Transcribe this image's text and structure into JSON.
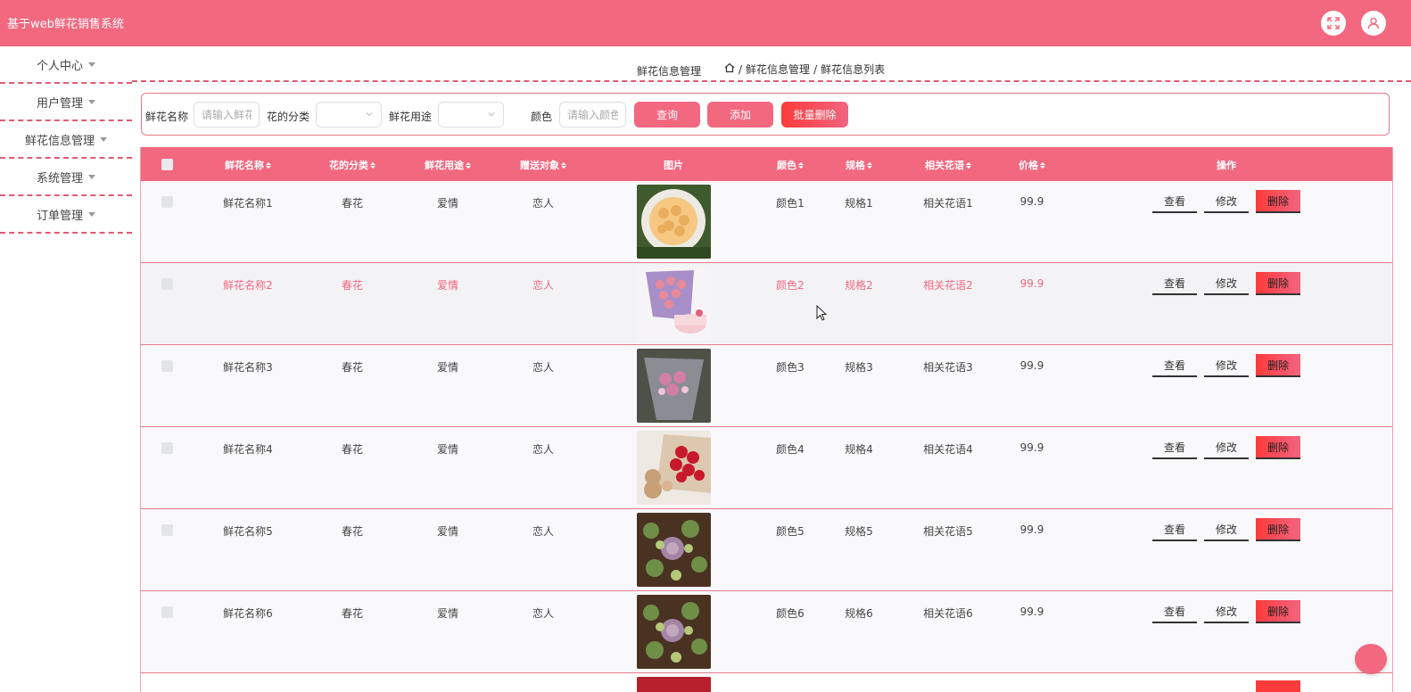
{
  "header": {
    "app_title": "基于web鲜花销售系统"
  },
  "sidebar": {
    "items": [
      {
        "label": "个人中心"
      },
      {
        "label": "用户管理"
      },
      {
        "label": "鲜花信息管理"
      },
      {
        "label": "系统管理"
      },
      {
        "label": "订单管理"
      }
    ]
  },
  "breadcrumb": {
    "page_title": "鲜花信息管理",
    "level1": "鲜花信息管理",
    "level2": "鲜花信息列表"
  },
  "search": {
    "name_label": "鲜花名称",
    "name_placeholder": "请输入鲜花名称",
    "category_label": "花的分类",
    "usage_label": "鲜花用途",
    "color_label": "颜色",
    "color_placeholder": "请输入颜色",
    "query_btn": "查询",
    "add_btn": "添加",
    "batch_delete_btn": "批量删除"
  },
  "table": {
    "headers": {
      "name": "鲜花名称",
      "category": "花的分类",
      "usage": "鲜花用途",
      "target": "赠送对象",
      "image": "图片",
      "color": "颜色",
      "spec": "规格",
      "language": "相关花语",
      "price": "价格",
      "ops": "操作"
    },
    "actions": {
      "view": "查看",
      "edit": "修改",
      "delete": "删除"
    },
    "rows": [
      {
        "name": "鲜花名称1",
        "category": "春花",
        "usage": "爱情",
        "target": "恋人",
        "color": "颜色1",
        "spec": "规格1",
        "language": "相关花语1",
        "price": "99.9",
        "img": "yellow-roses"
      },
      {
        "name": "鲜花名称2",
        "category": "春花",
        "usage": "爱情",
        "target": "恋人",
        "color": "颜色2",
        "spec": "规格2",
        "language": "相关花语2",
        "price": "99.9",
        "img": "pink-bouquet-cake"
      },
      {
        "name": "鲜花名称3",
        "category": "春花",
        "usage": "爱情",
        "target": "恋人",
        "color": "颜色3",
        "spec": "规格3",
        "language": "相关花语3",
        "price": "99.9",
        "img": "grey-wrapped-bouquet"
      },
      {
        "name": "鲜花名称4",
        "category": "春花",
        "usage": "爱情",
        "target": "恋人",
        "color": "颜色4",
        "spec": "规格4",
        "language": "相关花语4",
        "price": "99.9",
        "img": "red-roses-bear"
      },
      {
        "name": "鲜花名称5",
        "category": "春花",
        "usage": "爱情",
        "target": "恋人",
        "color": "颜色5",
        "spec": "规格5",
        "language": "相关花语5",
        "price": "99.9",
        "img": "succulents"
      },
      {
        "name": "鲜花名称6",
        "category": "春花",
        "usage": "爱情",
        "target": "恋人",
        "color": "颜色6",
        "spec": "规格6",
        "language": "相关花语6",
        "price": "99.9",
        "img": "succulents"
      }
    ]
  },
  "colors": {
    "primary": "#f2687f",
    "danger": "#fb3b3b"
  }
}
